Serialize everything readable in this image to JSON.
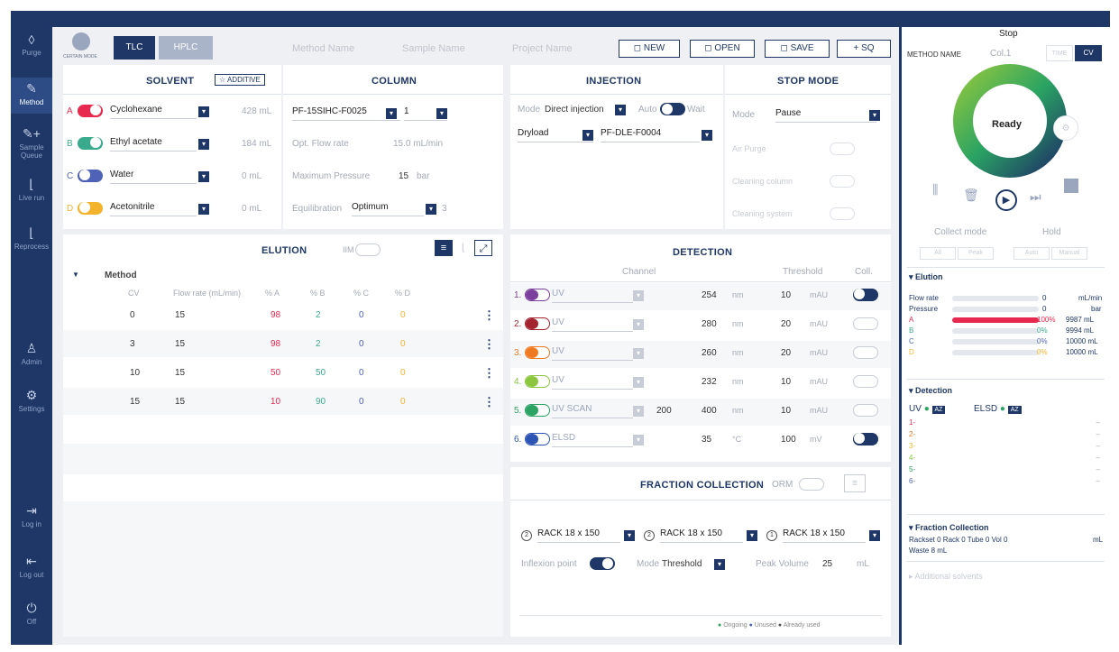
{
  "nav": [
    {
      "icon": "◊",
      "label": "Purge"
    },
    {
      "icon": "✎",
      "label": "Method"
    },
    {
      "icon": "✎+",
      "label": "Sample Queue"
    },
    {
      "icon": "⌊",
      "label": "Live run"
    },
    {
      "icon": "⌊",
      "label": "Reprocess"
    },
    {
      "icon": "♙",
      "label": "Admin"
    },
    {
      "icon": "⚙",
      "label": "Settings"
    },
    {
      "icon": "⇥",
      "label": "Log in"
    },
    {
      "icon": "⇤",
      "label": "Log out"
    },
    {
      "icon": "⏻",
      "label": "Off"
    }
  ],
  "topbar": {
    "mode_label": "CERTAIN MODE",
    "tlc": "TLC",
    "hplc": "HPLC",
    "method_ph": "Method Name",
    "sample_ph": "Sample Name",
    "project_ph": "Project Name",
    "new": "◻ NEW",
    "open": "◻ OPEN",
    "save": "◻ SAVE",
    "sq": "+ SQ"
  },
  "solvent": {
    "title": "SOLVENT",
    "additive": "☆ ADDITIVE",
    "rows": [
      {
        "letter": "A",
        "name": "Cyclohexane",
        "vol": "428 mL",
        "color": "#e8294f"
      },
      {
        "letter": "B",
        "name": "Ethyl acetate",
        "vol": "184 mL",
        "color": "#3aaa8c"
      },
      {
        "letter": "C",
        "name": "Water",
        "vol": "0 mL",
        "color": "#4e63b8"
      },
      {
        "letter": "D",
        "name": "Acetonitrile",
        "vol": "0 mL",
        "color": "#f3b32c"
      }
    ]
  },
  "column": {
    "title": "COLUMN",
    "name": "PF-15SIHC-F0025",
    "qty": "1",
    "flow_label": "Opt. Flow rate",
    "flow_val": "15.0 mL/min",
    "press_label": "Maximum Pressure",
    "press_val": "15",
    "press_unit": "bar",
    "equil_label": "Equilibration",
    "equil_val": "Optimum",
    "equil_num": "3"
  },
  "injection": {
    "title": "INJECTION",
    "mode_label": "Mode",
    "mode_val": "Direct injection",
    "auto": "Auto",
    "wait": "Wait",
    "type": "Dryload",
    "cart": "PF-DLE-F0004"
  },
  "stop": {
    "title": "STOP MODE",
    "mode_label": "Mode",
    "mode_val": "Pause",
    "air": "Air Purge",
    "cleaning_col": "Cleaning column",
    "cleaning_sys": "Cleaning system"
  },
  "elution": {
    "title": "ELUTION",
    "iim": "IIM",
    "method": "Method",
    "headers": [
      "CV",
      "Flow rate (mL/min)",
      "% A",
      "% B",
      "% C",
      "% D"
    ],
    "rows": [
      [
        "0",
        "15",
        "98",
        "2",
        "0",
        "0"
      ],
      [
        "3",
        "15",
        "98",
        "2",
        "0",
        "0"
      ],
      [
        "10",
        "15",
        "50",
        "50",
        "0",
        "0"
      ],
      [
        "15",
        "15",
        "10",
        "90",
        "0",
        "0"
      ]
    ]
  },
  "detection": {
    "title": "DETECTION",
    "channel": "Channel",
    "threshold": "Threshold",
    "coll": "Coll.",
    "rows": [
      {
        "n": "1.",
        "name": "UV",
        "from": "",
        "wl": "254",
        "unit": "nm",
        "th": "10",
        "tu": "mAU",
        "color": "#7b3f9e",
        "coll": true
      },
      {
        "n": "2.",
        "name": "UV",
        "from": "",
        "wl": "280",
        "unit": "nm",
        "th": "20",
        "tu": "mAU",
        "color": "#a3232f",
        "coll": false
      },
      {
        "n": "3.",
        "name": "UV",
        "from": "",
        "wl": "260",
        "unit": "nm",
        "th": "20",
        "tu": "mAU",
        "color": "#f07a22",
        "coll": false
      },
      {
        "n": "4.",
        "name": "UV",
        "from": "",
        "wl": "232",
        "unit": "nm",
        "th": "10",
        "tu": "mAU",
        "color": "#8cc63f",
        "coll": false
      },
      {
        "n": "5.",
        "name": "UV SCAN",
        "from": "200",
        "wl": "400",
        "unit": "nm",
        "th": "10",
        "tu": "mAU",
        "color": "#2aa363",
        "coll": false
      },
      {
        "n": "6.",
        "name": "ELSD",
        "from": "",
        "wl": "35",
        "unit": "°C",
        "th": "100",
        "tu": "mV",
        "color": "#2d54b5",
        "coll": true
      }
    ]
  },
  "fraction": {
    "title": "FRACTION COLLECTION",
    "orm": "ORM",
    "racks": [
      {
        "n": "2",
        "label": "RACK 18 x 150"
      },
      {
        "n": "2",
        "label": "RACK 18 x 150"
      },
      {
        "n": "1",
        "label": "RACK 18 x 150"
      }
    ],
    "inflexion": "Inflexion point",
    "mode_label": "Mode",
    "mode_val": "Threshold",
    "peak_label": "Peak Volume",
    "peak_val": "25",
    "peak_unit": "mL",
    "legend": [
      "Ongoing",
      "Unused",
      "Already used"
    ]
  },
  "right": {
    "stop": "Stop",
    "method_name": "METHOD NAME",
    "col": "Col.1",
    "time": "TIME",
    "cv": "CV",
    "status": "Ready",
    "collect_mode": "Collect mode",
    "hold": "Hold",
    "modes": [
      "All",
      "Peak",
      "Auto",
      "Manual"
    ],
    "elution_title": "▾ Elution",
    "flow_label": "Flow rate",
    "flow_val": "0",
    "flow_unit": "mL/min",
    "pres_label": "Pressure",
    "pres_val": "0",
    "pres_unit": "bar",
    "solv": [
      {
        "l": "A",
        "p": "100%",
        "v": "9987 mL",
        "c": "#e8294f",
        "pct": 1.0
      },
      {
        "l": "B",
        "p": "0%",
        "v": "9994 mL",
        "c": "#3aaa8c",
        "pct": 0
      },
      {
        "l": "C",
        "p": "0%",
        "v": "10000 mL",
        "c": "#4e63b8",
        "pct": 0
      },
      {
        "l": "D",
        "p": "0%",
        "v": "10000 mL",
        "c": "#f3b32c",
        "pct": 0
      }
    ],
    "det_title": "▾ Detection",
    "uv": "UV",
    "elsd": "ELSD",
    "az": "AZ",
    "det_rows": [
      "1-",
      "2-",
      "3-",
      "4-",
      "5-",
      "6-"
    ],
    "frac_title": "▾ Fraction Collection",
    "frac_line1": "Rackset 0  Rack 0  Tube 0  Vol  0",
    "frac_unit": "mL",
    "waste": "Waste   8    mL",
    "additional": "▸ Additional solvents"
  }
}
